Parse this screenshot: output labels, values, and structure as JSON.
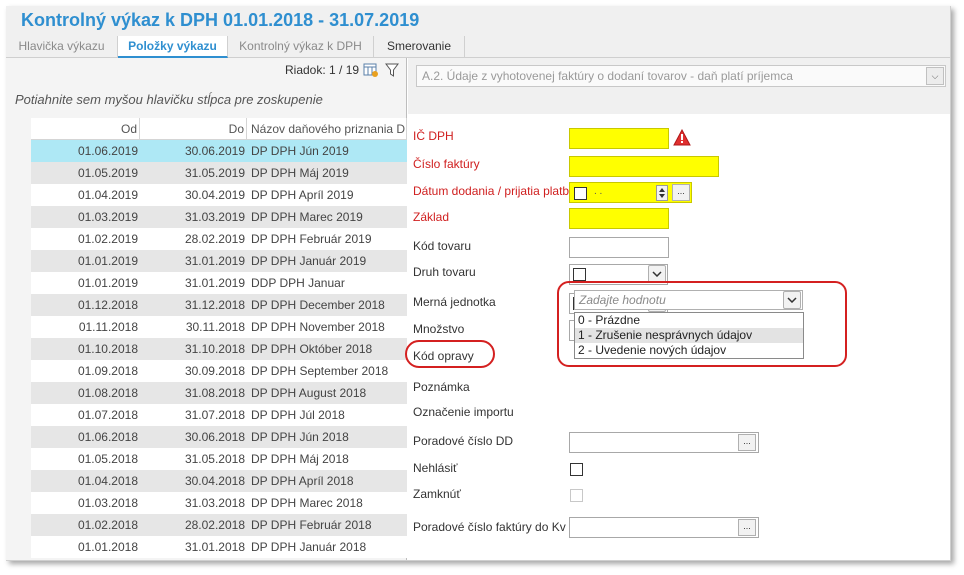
{
  "title": "Kontrolný výkaz k DPH 01.01.2018 - 31.07.2019",
  "tabs": [
    {
      "label": "Hlavička výkazu"
    },
    {
      "label": "Položky výkazu"
    },
    {
      "label": "Kontrolný výkaz k DPH"
    },
    {
      "label": "Smerovanie"
    }
  ],
  "toolbar": {
    "rows_label": "Riadok: 1 / 19"
  },
  "group_hint": "Potiahnite sem myšou hlavičku stĺpca pre zoskupenie",
  "grid": {
    "columns": [
      "Od",
      "Do",
      "Názov daňového priznania DPH"
    ],
    "rows": [
      [
        "01.06.2019",
        "30.06.2019",
        "DP DPH Jún 2019"
      ],
      [
        "01.05.2019",
        "31.05.2019",
        "DP DPH Máj 2019"
      ],
      [
        "01.04.2019",
        "30.04.2019",
        "DP DPH Apríl 2019"
      ],
      [
        "01.03.2019",
        "31.03.2019",
        "DP DPH Marec 2019"
      ],
      [
        "01.02.2019",
        "28.02.2019",
        "DP DPH Február 2019"
      ],
      [
        "01.01.2019",
        "31.01.2019",
        "DP DPH Január 2019"
      ],
      [
        "01.01.2019",
        "31.01.2019",
        "DDP DPH Januar"
      ],
      [
        "01.12.2018",
        "31.12.2018",
        "DP DPH December 2018"
      ],
      [
        "01.11.2018",
        "30.11.2018",
        "DP DPH November 2018"
      ],
      [
        "01.10.2018",
        "31.10.2018",
        "DP DPH Október 2018"
      ],
      [
        "01.09.2018",
        "30.09.2018",
        "DP DPH September 2018"
      ],
      [
        "01.08.2018",
        "31.08.2018",
        "DP DPH August 2018"
      ],
      [
        "01.07.2018",
        "31.07.2018",
        "DP DPH Júl 2018"
      ],
      [
        "01.06.2018",
        "30.06.2018",
        "DP DPH Jún 2018"
      ],
      [
        "01.05.2018",
        "31.05.2018",
        "DP DPH Máj 2018"
      ],
      [
        "01.04.2018",
        "30.04.2018",
        "DP DPH Apríl 2018"
      ],
      [
        "01.03.2018",
        "31.03.2018",
        "DP DPH Marec 2018"
      ],
      [
        "01.02.2018",
        "28.02.2018",
        "DP DPH Február 2018"
      ],
      [
        "01.01.2018",
        "31.01.2018",
        "DP DPH Január 2018"
      ]
    ]
  },
  "section_select": "A.2. Údaje z vyhotovenej faktúry o dodaní tovarov - daň platí príjemca",
  "form": {
    "ic_dph": "IČ DPH",
    "cislo_faktury": "Číslo faktúry",
    "datum_dodania": "Dátum dodania / prijatia platby",
    "zaklad": "Základ",
    "kod_tovaru": "Kód tovaru",
    "druh_tovaru": "Druh tovaru",
    "merna_jednotka": "Merná jednotka",
    "mnozstvo": "Množstvo",
    "kod_opravy": "Kód opravy",
    "poznamka": "Poznámka",
    "oznacenie_importu": "Označenie importu",
    "poradove_cislo_dd": "Poradové číslo DD",
    "nehlasit": "Nehlásiť",
    "zamknut": "Zamknúť",
    "poradove_cislo_faktury": "Poradové číslo faktúry do Kv"
  },
  "kod_opravy_combo": {
    "placeholder": "Zadajte hodnotu",
    "options": [
      "0 - Prázdne",
      "1 - Zrušenie nesprávnych údajov",
      "2 - Uvedenie nových údajov"
    ]
  },
  "colors": {
    "accent": "#2f8fd0",
    "required": "#d02020",
    "highlight_field": "#ffff00",
    "selected_row": "#aee8f5",
    "annotation": "#d42020"
  }
}
